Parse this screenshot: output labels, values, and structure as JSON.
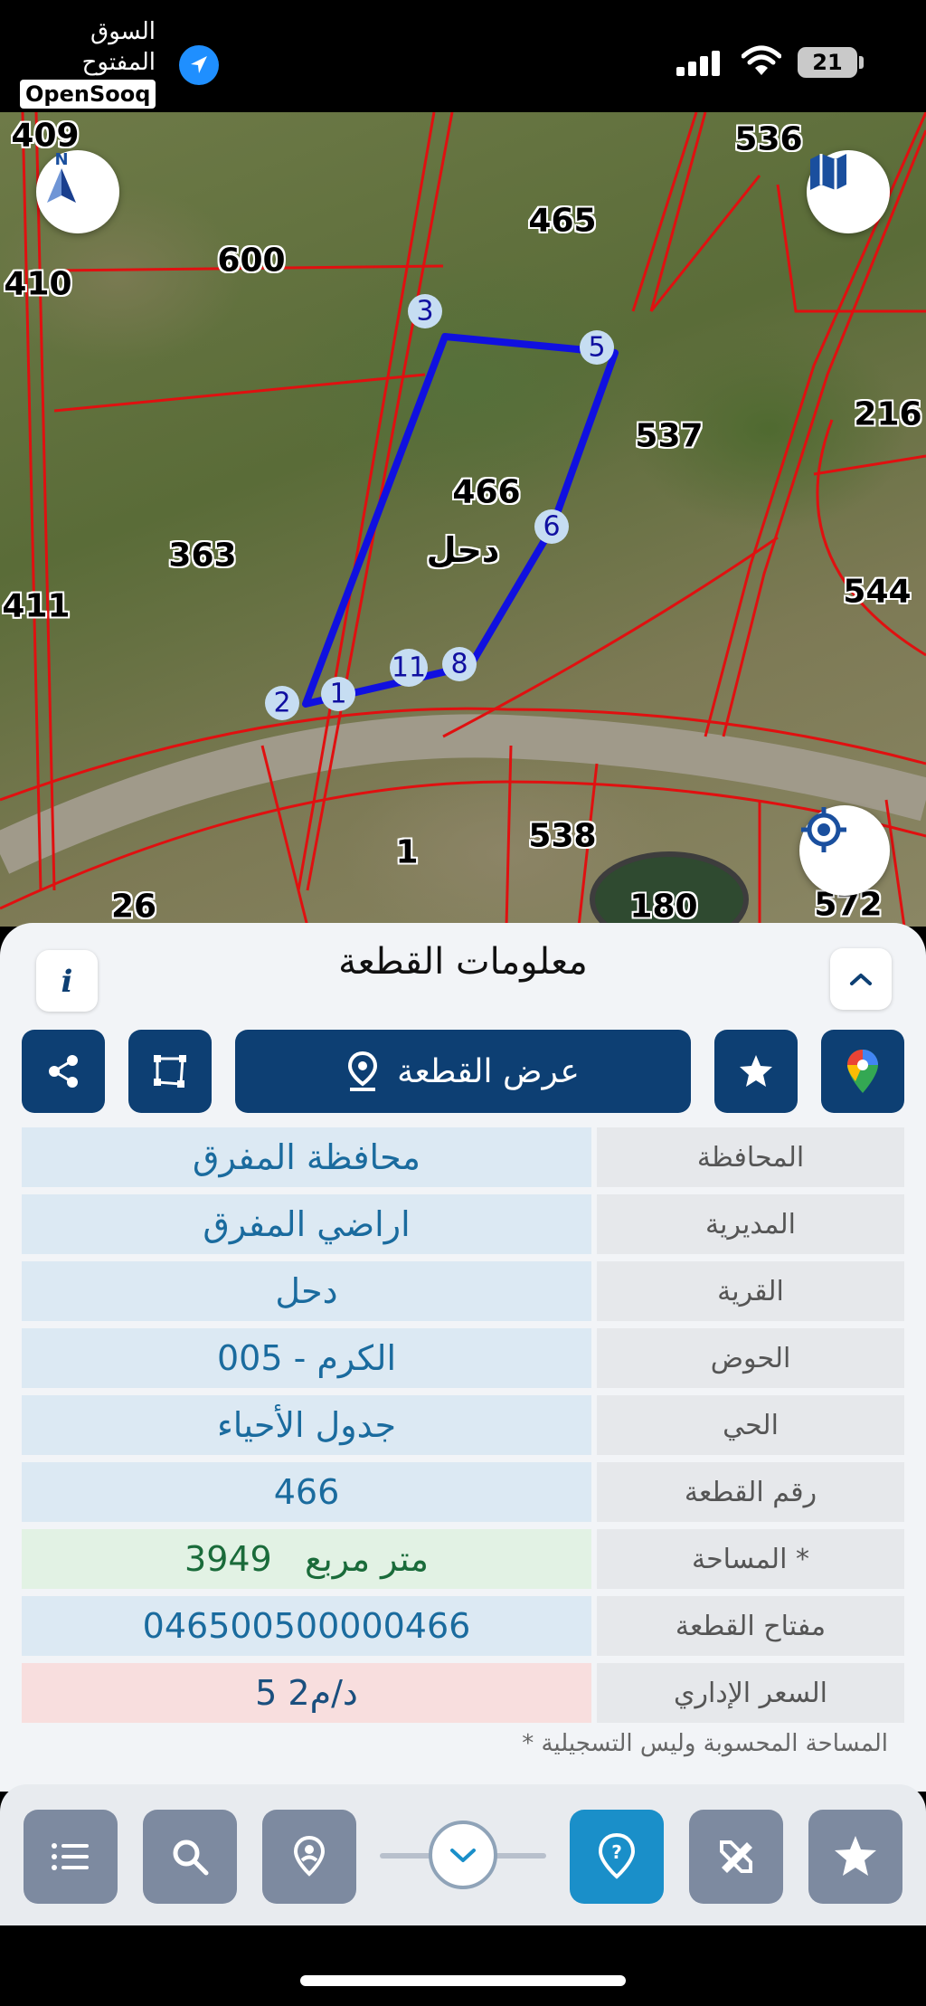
{
  "status_bar": {
    "watermark_ar": "السوق المفتوح",
    "watermark_en": "OpenSooq",
    "battery": "21"
  },
  "map": {
    "parcel_labels": [
      "409",
      "410",
      "600",
      "465",
      "536",
      "216",
      "537",
      "466",
      "363",
      "411",
      "544",
      "1",
      "538",
      "26",
      "180",
      "572"
    ],
    "village_label": "دحل",
    "vertex_labels": [
      "3",
      "5",
      "6",
      "8",
      "11",
      "1",
      "2"
    ]
  },
  "panel": {
    "title": "معلومات القطعة",
    "show_parcel_button": "عرض القطعة",
    "rows": [
      {
        "label": "المحافظة",
        "value": "محافظة المفرق"
      },
      {
        "label": "المديرية",
        "value": "اراضي المفرق"
      },
      {
        "label": "القرية",
        "value": "دحل"
      },
      {
        "label": "الحوض",
        "value": "الكرم - 005"
      },
      {
        "label": "الحي",
        "value": "جدول الأحياء"
      },
      {
        "label": "رقم القطعة",
        "value": "466"
      },
      {
        "label": "المساحة *",
        "value": "3949   متر مربع"
      },
      {
        "label": "مفتاح القطعة",
        "value": "046500500000466"
      },
      {
        "label": "السعر الإداري",
        "value": "5 د/م2"
      }
    ],
    "footnote": "* المساحة المحسوبة وليس التسجيلية"
  },
  "icons": {
    "info": "info-icon",
    "collapse": "chevron-up-icon",
    "share": "share-icon",
    "polygon": "polygon-icon",
    "location_pin": "location-pin-icon",
    "favorite": "star-icon",
    "google_maps": "google-maps-icon"
  },
  "colors": {
    "primary": "#0d3f73",
    "accent": "#1a8fc9",
    "parcel_outline": "#1010e0",
    "boundary": "#e01010"
  }
}
